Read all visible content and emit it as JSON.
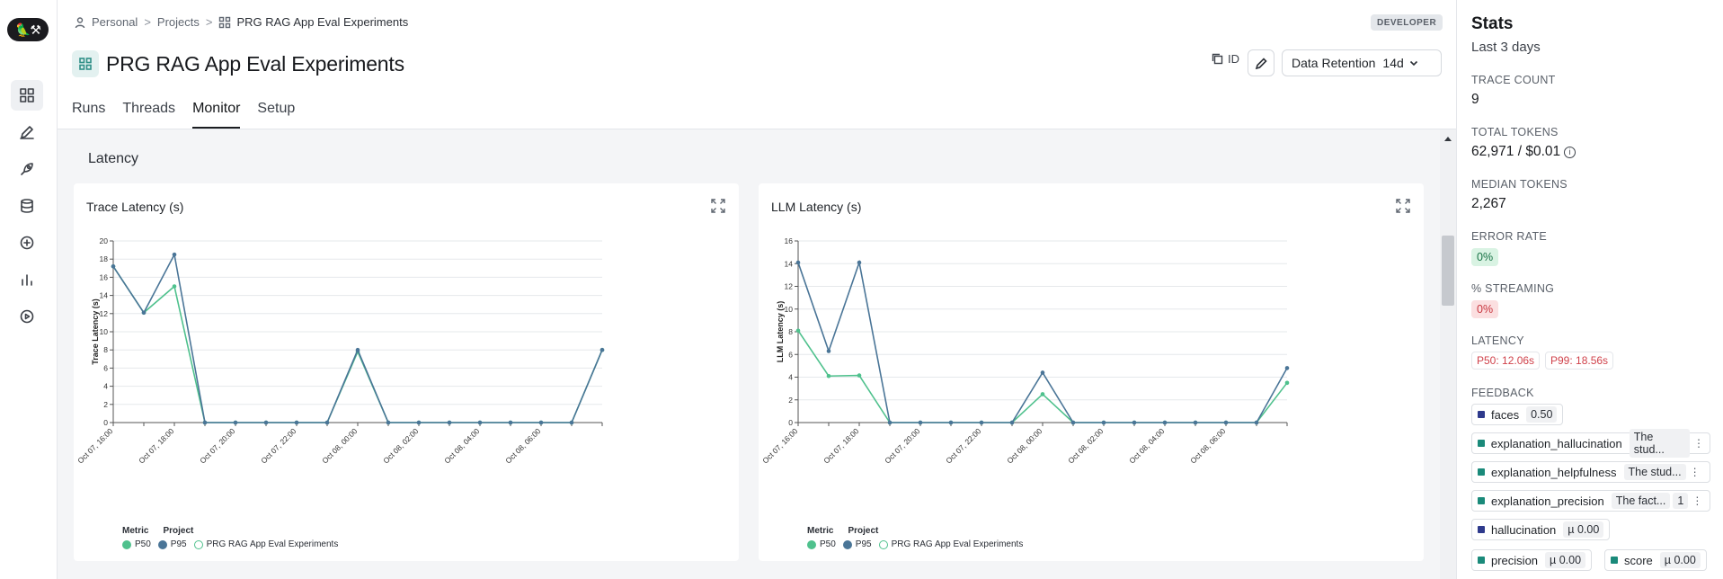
{
  "breadcrumb": {
    "items": [
      "Personal",
      "Projects",
      "PRG RAG App Eval Experiments"
    ]
  },
  "env_badge": "DEVELOPER",
  "project_title": "PRG RAG App Eval Experiments",
  "header": {
    "id_label": "ID",
    "retention_label": "Data Retention",
    "retention_value": "14d"
  },
  "tabs": [
    {
      "label": "Runs"
    },
    {
      "label": "Threads"
    },
    {
      "label": "Monitor",
      "active": true
    },
    {
      "label": "Setup"
    }
  ],
  "section_title": "Latency",
  "charts": [
    {
      "title": "Trace Latency (s)",
      "ylabel": "Trace Latency (s)",
      "legend": {
        "metric_header": "Metric",
        "project_header": "Project",
        "p50": "P50",
        "p95": "P95",
        "project": "PRG RAG App Eval Experiments"
      }
    },
    {
      "title": "LLM Latency (s)",
      "ylabel": "LLM Latency (s)",
      "legend": {
        "metric_header": "Metric",
        "project_header": "Project",
        "p50": "P50",
        "p95": "P95",
        "project": "PRG RAG App Eval Experiments"
      }
    }
  ],
  "chart_data": [
    {
      "type": "line",
      "title": "Trace Latency (s)",
      "xlabel": "",
      "ylabel": "Trace Latency (s)",
      "ylim": [
        0,
        20
      ],
      "yticks": [
        0,
        2,
        4,
        6,
        8,
        10,
        12,
        14,
        16,
        18,
        20
      ],
      "x": [
        "Oct 07, 16:00",
        "",
        "Oct 07, 18:00",
        "",
        "Oct 07, 20:00",
        "",
        "Oct 07, 22:00",
        "",
        "Oct 08, 00:00",
        "",
        "Oct 08, 02:00",
        "",
        "Oct 08, 04:00",
        "",
        "Oct 08, 06:00",
        "",
        ""
      ],
      "series": [
        {
          "name": "P50",
          "color": "#4fc18d",
          "values": [
            17.2,
            12.1,
            15.0,
            0,
            0,
            0,
            0,
            0,
            7.8,
            0,
            0,
            0,
            0,
            0,
            0,
            0,
            8.0
          ]
        },
        {
          "name": "P95",
          "color": "#4a7597",
          "values": [
            17.2,
            12.1,
            18.5,
            0,
            0,
            0,
            0,
            0,
            8.0,
            0,
            0,
            0,
            0,
            0,
            0,
            0,
            8.0
          ]
        }
      ],
      "grid": true,
      "legend_position": "bottom-left"
    },
    {
      "type": "line",
      "title": "LLM Latency (s)",
      "xlabel": "",
      "ylabel": "LLM Latency (s)",
      "ylim": [
        0,
        16
      ],
      "yticks": [
        0,
        2,
        4,
        6,
        8,
        10,
        12,
        14,
        16
      ],
      "x": [
        "Oct 07, 16:00",
        "",
        "Oct 07, 18:00",
        "",
        "Oct 07, 20:00",
        "",
        "Oct 07, 22:00",
        "",
        "Oct 08, 00:00",
        "",
        "Oct 08, 02:00",
        "",
        "Oct 08, 04:00",
        "",
        "Oct 08, 06:00",
        "",
        ""
      ],
      "series": [
        {
          "name": "P50",
          "color": "#4fc18d",
          "values": [
            8.1,
            4.1,
            4.15,
            0,
            0,
            0,
            0,
            0,
            2.5,
            0,
            0,
            0,
            0,
            0,
            0,
            0,
            3.5
          ]
        },
        {
          "name": "P95",
          "color": "#4a7597",
          "values": [
            14.1,
            6.3,
            14.1,
            0,
            0,
            0,
            0,
            0,
            4.4,
            0,
            0,
            0,
            0,
            0,
            0,
            0,
            4.8
          ]
        }
      ],
      "grid": true,
      "legend_position": "bottom-left"
    }
  ],
  "stats": {
    "title": "Stats",
    "subtitle": "Last 3 days",
    "trace_count_label": "TRACE COUNT",
    "trace_count": "9",
    "total_tokens_label": "TOTAL TOKENS",
    "total_tokens": "62,971 / $0.01",
    "median_tokens_label": "MEDIAN TOKENS",
    "median_tokens": "2,267",
    "error_rate_label": "ERROR RATE",
    "error_rate": "0%",
    "streaming_label": "% STREAMING",
    "streaming": "0%",
    "latency_label": "LATENCY",
    "latency_p50": "P50: 12.06s",
    "latency_p99": "P99: 18.56s",
    "feedback_label": "FEEDBACK",
    "feedback": [
      {
        "name": "faces",
        "value": "0.50",
        "color": "#2e3a8c"
      },
      {
        "name": "explanation_hallucination",
        "value": "The stud...",
        "color": "#1a8a7a"
      },
      {
        "name": "explanation_helpfulness",
        "value": "The stud...",
        "color": "#1a8a7a"
      },
      {
        "name": "explanation_precision",
        "value": "The fact...",
        "extra": "1",
        "color": "#1a8a7a"
      },
      {
        "name": "hallucination",
        "value": "µ 0.00",
        "color": "#2e3a8c"
      },
      {
        "name": "precision",
        "value": "µ 0.00",
        "color": "#1a8a7a"
      },
      {
        "name": "score",
        "value": "µ 0.00",
        "color": "#1a8a7a"
      }
    ]
  }
}
